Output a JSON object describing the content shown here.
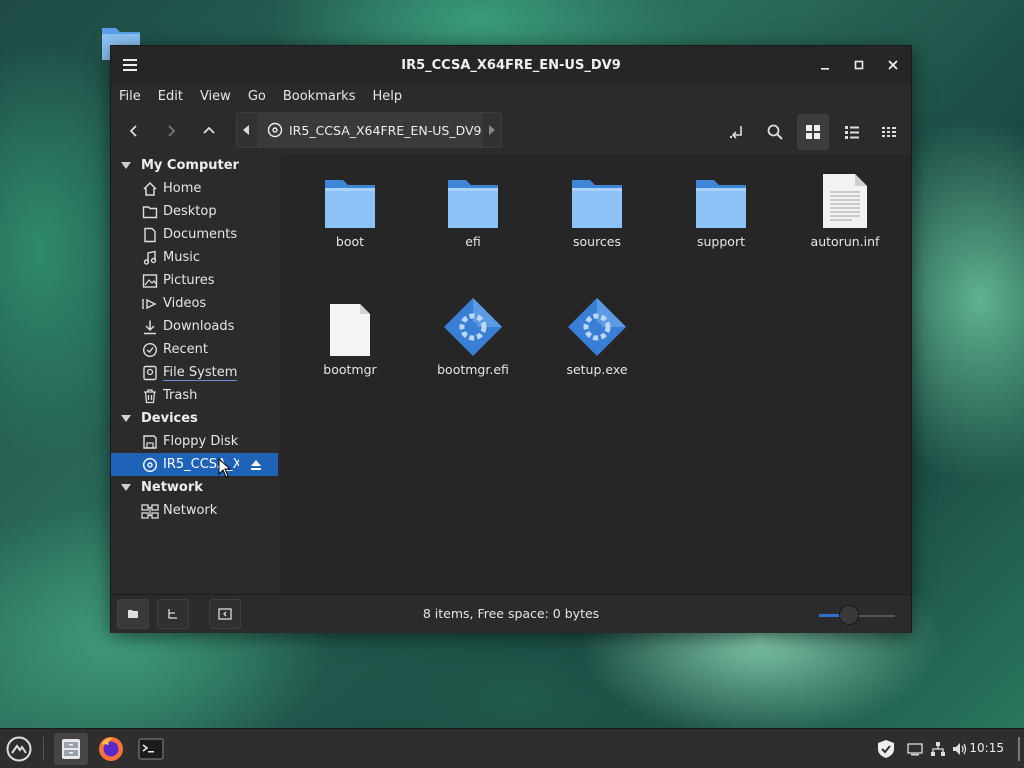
{
  "window": {
    "title": "IR5_CCSA_X64FRE_EN-US_DV9",
    "controls": [
      "minimize",
      "maximize",
      "close"
    ]
  },
  "menubar": [
    "File",
    "Edit",
    "View",
    "Go",
    "Bookmarks",
    "Help"
  ],
  "pathbar": {
    "segment": "IR5_CCSA_X64FRE_EN-US_DV9"
  },
  "sidebar": {
    "sections": [
      {
        "title": "My Computer",
        "items": [
          {
            "label": "Home",
            "icon": "home-icon"
          },
          {
            "label": "Desktop",
            "icon": "desktop-icon"
          },
          {
            "label": "Documents",
            "icon": "documents-icon"
          },
          {
            "label": "Music",
            "icon": "music-icon"
          },
          {
            "label": "Pictures",
            "icon": "pictures-icon"
          },
          {
            "label": "Videos",
            "icon": "videos-icon"
          },
          {
            "label": "Downloads",
            "icon": "downloads-icon"
          },
          {
            "label": "Recent",
            "icon": "recent-icon"
          },
          {
            "label": "File System",
            "icon": "filesystem-icon"
          },
          {
            "label": "Trash",
            "icon": "trash-icon"
          }
        ]
      },
      {
        "title": "Devices",
        "items": [
          {
            "label": "Floppy Disk",
            "icon": "floppy-icon"
          },
          {
            "label": "IR5_CCSA_X...",
            "icon": "disc-icon",
            "selected": true
          }
        ]
      },
      {
        "title": "Network",
        "items": [
          {
            "label": "Network",
            "icon": "network-icon"
          }
        ]
      }
    ]
  },
  "files": [
    {
      "name": "boot",
      "type": "folder"
    },
    {
      "name": "efi",
      "type": "folder"
    },
    {
      "name": "sources",
      "type": "folder"
    },
    {
      "name": "support",
      "type": "folder"
    },
    {
      "name": "autorun.inf",
      "type": "text"
    },
    {
      "name": "bootmgr",
      "type": "blank"
    },
    {
      "name": "bootmgr.efi",
      "type": "executable"
    },
    {
      "name": "setup.exe",
      "type": "executable"
    }
  ],
  "status": {
    "text": "8 items, Free space: 0 bytes",
    "zoom_level": 0.4
  },
  "taskbar": {
    "clock": "10:15"
  },
  "colors": {
    "accent": "#1e63b8",
    "folder": "#5aa0e8",
    "window_bg": "#2b2b2b",
    "content_bg": "#262626"
  }
}
